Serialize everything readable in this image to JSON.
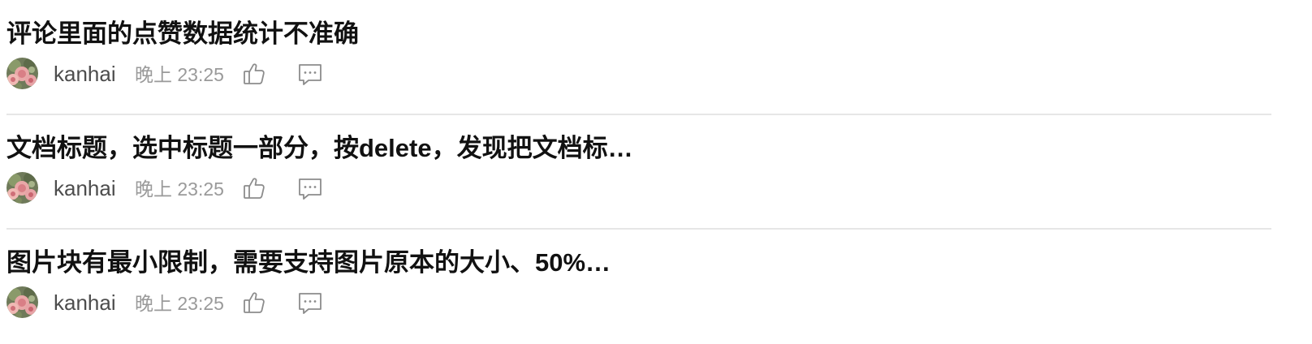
{
  "posts": [
    {
      "title": "评论里面的点赞数据统计不准确",
      "author": "kanhai",
      "time": "晚上 23:25",
      "avatar_icon": "flower-avatar",
      "like_icon": "thumbs-up-icon",
      "comment_icon": "comment-icon"
    },
    {
      "title": "文档标题，选中标题一部分，按delete，发现把文档标…",
      "author": "kanhai",
      "time": "晚上 23:25",
      "avatar_icon": "flower-avatar",
      "like_icon": "thumbs-up-icon",
      "comment_icon": "comment-icon"
    },
    {
      "title": "图片块有最小限制，需要支持图片原本的大小、50%…",
      "author": "kanhai",
      "time": "晚上 23:25",
      "avatar_icon": "flower-avatar",
      "like_icon": "thumbs-up-icon",
      "comment_icon": "comment-icon"
    }
  ],
  "colors": {
    "title": "#111111",
    "author": "#4d4d4d",
    "time": "#9a9a9a",
    "icon": "#8c8c8c",
    "divider": "#e6e6e6"
  }
}
